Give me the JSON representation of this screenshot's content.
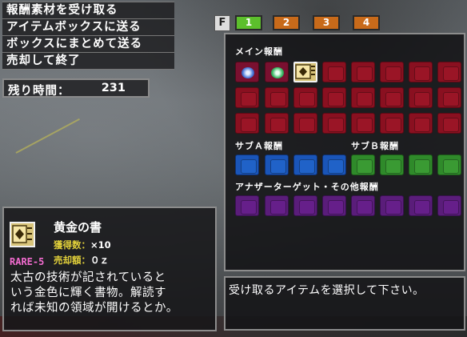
{
  "menu": {
    "items": [
      "報酬素材を受け取る",
      "アイテムボックスに送る",
      "ボックスにまとめて送る",
      "売却して終了"
    ]
  },
  "timer": {
    "label": "残り時間：",
    "value": "231"
  },
  "tabs": {
    "f_key": "F",
    "labels": [
      "1",
      "2",
      "3",
      "4"
    ],
    "active": "1"
  },
  "rewards": {
    "main_label": "メイン報酬",
    "sub_a_label": "サブＡ報酬",
    "sub_b_label": "サブＢ報酬",
    "other_label": "アナザーターゲット・その他報酬"
  },
  "message": "受け取るアイテムを選択して下さい。",
  "item": {
    "name": "黄金の書",
    "qty_label": "獲得数：",
    "qty_value": "×10",
    "price_label": "売却額：",
    "price_value": "０ｚ",
    "rarity": "RARE-5",
    "desc_lines": [
      "太古の技術が記されていると",
      "いう金色に輝く書物。解読す",
      "れば未知の領域が開けるとか。"
    ]
  },
  "colors": {
    "main": "#8a1020",
    "sub_a": "#1a55b8",
    "sub_b": "#2f8a2a",
    "other": "#5a1d7a",
    "tab_active": "#5cbf2c",
    "tab": "#c86a1a",
    "rarity": "#f36cd0"
  }
}
